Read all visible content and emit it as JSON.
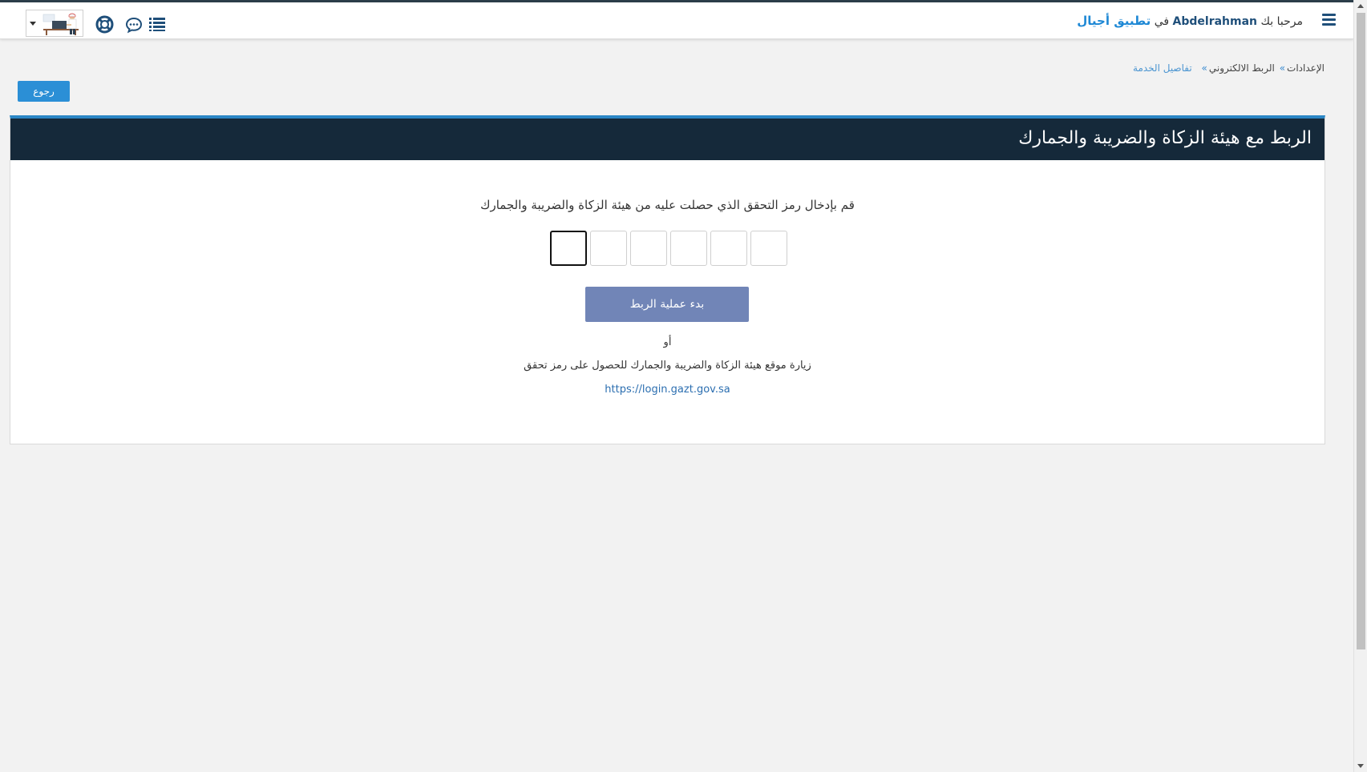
{
  "header": {
    "welcome_prefix": "مرحبا بك",
    "username": "Abdelrahman",
    "in_word": "في",
    "app_name": "تطبيق أجيال",
    "icons": [
      "menu-icon",
      "list-icon",
      "chat-icon",
      "support-icon",
      "avatar",
      "dropdown-caret"
    ]
  },
  "breadcrumb": {
    "items": [
      "الإعدادات",
      "الربط الالكتروني",
      "تفاصيل الخدمة"
    ],
    "separator": "»"
  },
  "back_button": "رجوع",
  "panel": {
    "title": "الربط مع هيئة الزكاة والضريبة والجمارك",
    "instruction": "قم بإدخال رمز التحقق الذي حصلت عليه من هيئة الزكاة والضريبة والجمارك",
    "otp_digits": [
      "",
      "",
      "",
      "",
      "",
      ""
    ],
    "start_button": "بدء عملية الربط",
    "or_text": "أو",
    "visit_text": "زيارة موقع هيئة الزكاة والضريبة والجمارك للحصول على رمز تحقق",
    "link": "https://login.gazt.gov.sa"
  },
  "colors": {
    "panel_header_bg": "#15293a",
    "panel_top_border": "#2b86c5",
    "back_button_bg": "#2b8fd6",
    "start_button_bg": "#7185b7",
    "app_name_color": "#1e88d5",
    "icon_color": "#1f4f7a"
  }
}
